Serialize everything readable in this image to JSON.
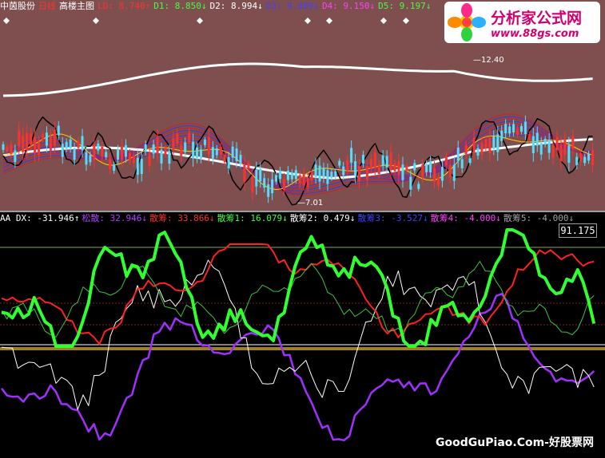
{
  "main": {
    "header": [
      {
        "text": "中茵股份",
        "color": "#ffffff"
      },
      {
        "text": "日线",
        "color": "#ff3030"
      },
      {
        "text": "高楼主图",
        "color": "#ffffff"
      },
      {
        "text": "LD: 8.740↑",
        "color": "#ff3030"
      },
      {
        "text": "D1: 8.850↓",
        "color": "#40ff40"
      },
      {
        "text": "D2: 8.994↓",
        "color": "#ffffff"
      },
      {
        "text": "D3: 9.089↓",
        "color": "#4040ff"
      },
      {
        "text": "D4: 9.150↓",
        "color": "#ff40ff"
      },
      {
        "text": "D5: 9.197↓",
        "color": "#40ff40"
      }
    ],
    "high_label": "12.40",
    "low_label": "7.01"
  },
  "indicator": {
    "header": [
      {
        "text": "AA DX: -31.946↑",
        "color": "#ffffff"
      },
      {
        "text": "松散: 32.946↓",
        "color": "#b040ff"
      },
      {
        "text": "散筹: 33.866↓",
        "color": "#ff3030"
      },
      {
        "text": "散筹1: 16.079↓",
        "color": "#40ff40"
      },
      {
        "text": "散筹2: 0.479↓",
        "color": "#ffffff"
      },
      {
        "text": "散筹3: -3.527↓",
        "color": "#4040ff"
      },
      {
        "text": "散筹4: -4.000↓",
        "color": "#ff40ff"
      },
      {
        "text": "散筹5: -4.000↓",
        "color": "#a0a0a0"
      }
    ],
    "value_box": "91.175"
  },
  "logo": {
    "title": "分析家公式网",
    "url": "www.88gs.com"
  },
  "watermark": "GoodGuPiao.Com-好股票网",
  "colors": {
    "main_bg": "#7f4f4f",
    "indicator_bg": "#000000",
    "divider": "#9aa0a0",
    "logo_accent": "#d0006f"
  },
  "icons": [
    "diamond-marker-icon",
    "logo-icon"
  ]
}
